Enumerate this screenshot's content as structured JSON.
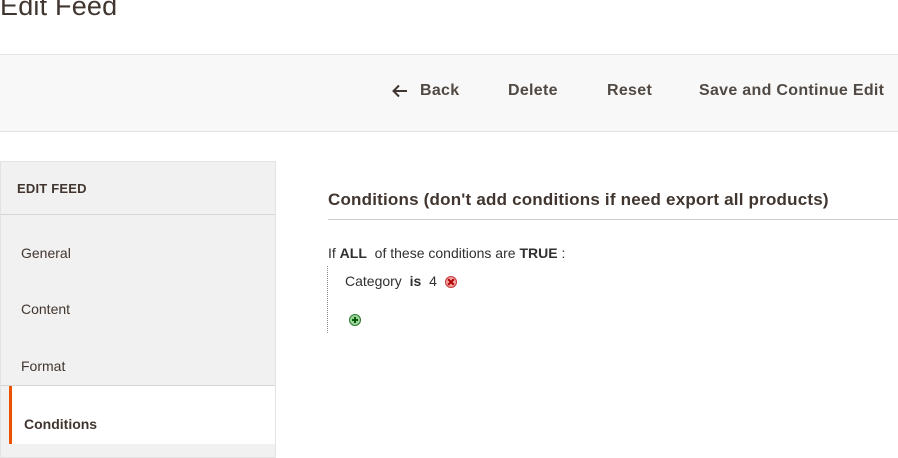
{
  "page": {
    "title": "Edit Feed"
  },
  "toolbar": {
    "back_label": "Back",
    "delete_label": "Delete",
    "reset_label": "Reset",
    "save_continue_label": "Save and Continue Edit"
  },
  "sidebar": {
    "title": "EDIT FEED",
    "items": [
      {
        "label": "General",
        "active": false
      },
      {
        "label": "Content",
        "active": false
      },
      {
        "label": "Format",
        "active": false
      },
      {
        "label": "Conditions",
        "active": true
      }
    ]
  },
  "conditions": {
    "heading": "Conditions (don't add conditions if need export all products)",
    "prefix": "If",
    "aggregator": "ALL",
    "middle": "of these conditions are",
    "value": "TRUE",
    "suffix": ":",
    "rule": {
      "attribute": "Category",
      "operator": "is",
      "value": "4"
    },
    "icons": {
      "remove": "remove-icon",
      "add": "add-icon"
    }
  },
  "colors": {
    "accent": "#eb5202",
    "text": "#41362f"
  }
}
